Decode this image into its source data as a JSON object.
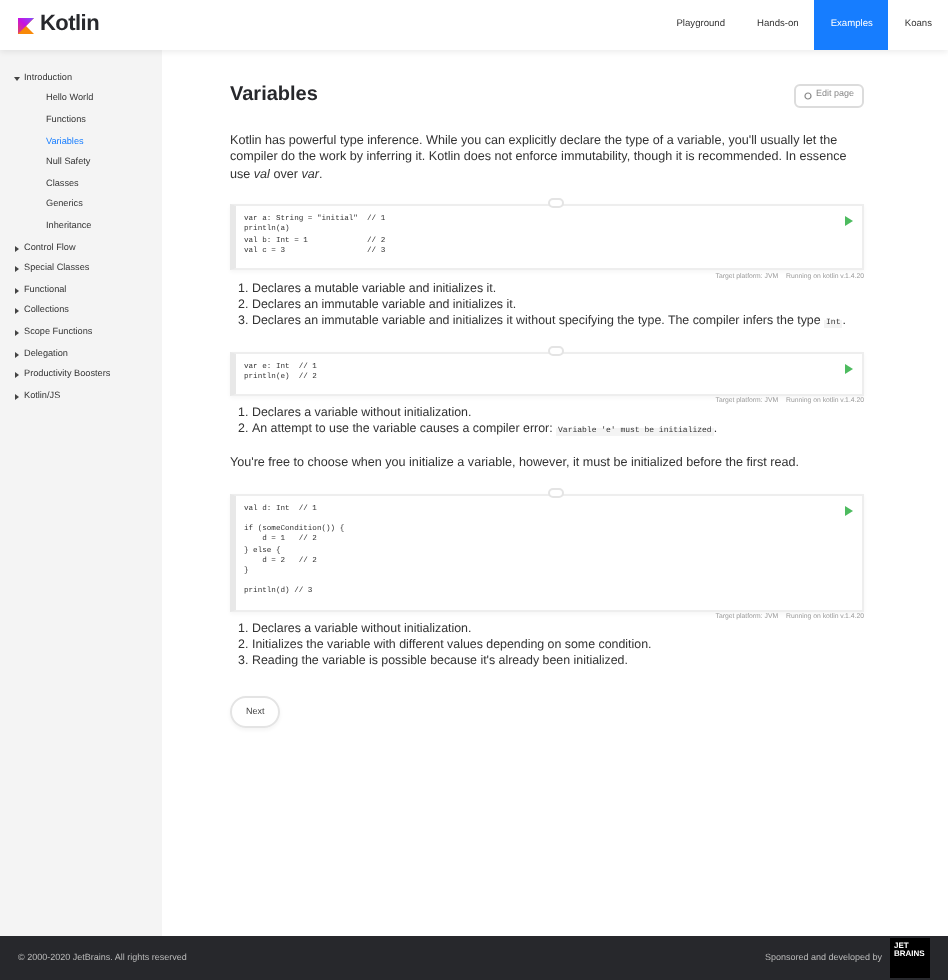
{
  "header": {
    "logo": "Kotlin",
    "nav": [
      {
        "label": "Playground",
        "selected": false
      },
      {
        "label": "Hands-on",
        "selected": false
      },
      {
        "label": "Examples",
        "selected": true
      },
      {
        "label": "Koans",
        "selected": false
      }
    ]
  },
  "sidebar": {
    "items": [
      {
        "label": "Introduction",
        "expanded": true,
        "children": [
          {
            "label": "Hello World",
            "selected": false
          },
          {
            "label": "Functions",
            "selected": false
          },
          {
            "label": "Variables",
            "selected": true
          },
          {
            "label": "Null Safety",
            "selected": false
          },
          {
            "label": "Classes",
            "selected": false
          },
          {
            "label": "Generics",
            "selected": false
          },
          {
            "label": "Inheritance",
            "selected": false
          }
        ]
      },
      {
        "label": "Control Flow",
        "expanded": false
      },
      {
        "label": "Special Classes",
        "expanded": false
      },
      {
        "label": "Functional",
        "expanded": false
      },
      {
        "label": "Collections",
        "expanded": false
      },
      {
        "label": "Scope Functions",
        "expanded": false
      },
      {
        "label": "Delegation",
        "expanded": false
      },
      {
        "label": "Productivity Boosters",
        "expanded": false
      },
      {
        "label": "Kotlin/JS",
        "expanded": false
      }
    ]
  },
  "content": {
    "title": "Variables",
    "edit_button": "Edit page",
    "blocks": [
      {
        "kind": "paragraph",
        "text": "Kotlin has powerful type inference. While you can explicitly declare the type of a variable, you'll usually let the compiler do the work by inferring it. Kotlin does not enforce immutability, though it is recommended. In essence use *val* over *var*."
      },
      {
        "kind": "code",
        "code": "var a: String = \"initial\"  // 1\nprintln(a)\nval b: Int = 1             // 2\nval c = 3                  // 3",
        "platform": "Target platform: JVM",
        "version": "Running on kotlin v.1.4.20"
      },
      {
        "kind": "list",
        "items": [
          {
            "number": "1.",
            "parts": [
              {
                "kind": "text",
                "text": "Declares a mutable variable and initializes it."
              }
            ]
          },
          {
            "number": "2.",
            "parts": [
              {
                "kind": "text",
                "text": "Declares an immutable variable and initializes it."
              }
            ]
          },
          {
            "number": "3.",
            "parts": [
              {
                "kind": "text",
                "text": "Declares an immutable variable and initializes it without specifying the type. The compiler infers the type "
              },
              {
                "kind": "code",
                "text": "Int"
              },
              {
                "kind": "text",
                "text": "."
              }
            ]
          }
        ]
      },
      {
        "kind": "code",
        "code": "var e: Int  // 1\nprintln(e)  // 2",
        "platform": "Target platform: JVM",
        "version": "Running on kotlin v.1.4.20"
      },
      {
        "kind": "list",
        "items": [
          {
            "number": "1.",
            "parts": [
              {
                "kind": "text",
                "text": "Declares a variable without initialization."
              }
            ]
          },
          {
            "number": "2.",
            "parts": [
              {
                "kind": "text",
                "text": "An attempt to use the variable causes a compiler error: "
              },
              {
                "kind": "code",
                "text": "Variable 'e' must be initialized"
              },
              {
                "kind": "text",
                "text": "."
              }
            ]
          }
        ]
      },
      {
        "kind": "paragraph",
        "text": "You're free to choose when you initialize a variable, however, it must be initialized before the first read."
      },
      {
        "kind": "code",
        "code": "val d: Int  // 1\n\nif (someCondition()) {\n    d = 1   // 2\n} else {\n    d = 2   // 2\n}\n\nprintln(d) // 3",
        "platform": "Target platform: JVM",
        "version": "Running on kotlin v.1.4.20"
      },
      {
        "kind": "list",
        "items": [
          {
            "number": "1.",
            "parts": [
              {
                "kind": "text",
                "text": "Declares a variable without initialization."
              }
            ]
          },
          {
            "number": "2.",
            "parts": [
              {
                "kind": "text",
                "text": "Initializes the variable with different values depending on some condition."
              }
            ]
          },
          {
            "number": "3.",
            "parts": [
              {
                "kind": "text",
                "text": "Reading the variable is possible because it's already been initialized."
              }
            ]
          }
        ]
      }
    ],
    "next_button": "Next"
  },
  "footer": {
    "copyright": "© 2000-2020 JetBrains. All rights reserved",
    "sponsor": "Sponsored and developed by",
    "sponsor_logo": "JET BRAINS"
  }
}
